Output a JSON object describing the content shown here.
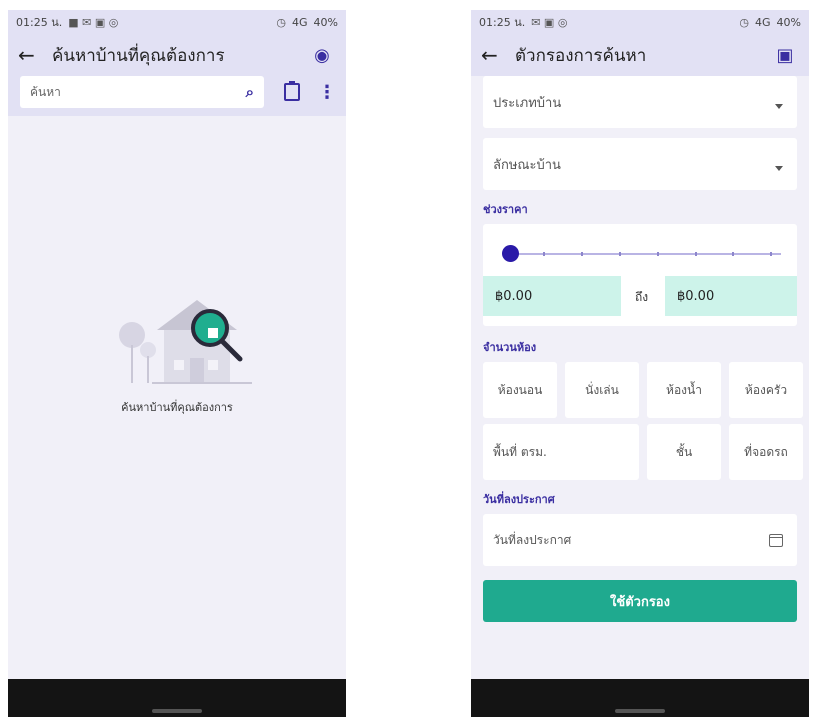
{
  "left": {
    "status": {
      "time": "01:25 น.",
      "signal": "4G",
      "battery": "40%"
    },
    "appbar": {
      "title": "ค้นหาบ้านที่คุณต้องการ"
    },
    "search": {
      "placeholder": "ค้นหา"
    },
    "empty_state": {
      "message": "ค้นหาบ้านที่คุณต้องการ"
    }
  },
  "right": {
    "status": {
      "time": "01:25 น.",
      "signal": "4G",
      "battery": "40%"
    },
    "appbar": {
      "title": "ตัวกรองการค้นหา"
    },
    "filters": {
      "house_type": "ประเภทบ้าน",
      "house_style": "ลักษณะบ้าน",
      "price_range_label": "ช่วงราคา",
      "price_min": "฿0.00",
      "price_to": "ถึง",
      "price_max": "฿0.00",
      "price_slider_value": 0,
      "rooms_label": "จำนวนห้อง",
      "rooms": [
        "ห้องนอน",
        "นั่งเล่น",
        "ห้องน้ำ",
        "ห้องครัว"
      ],
      "area": "พื้นที่ ตรม.",
      "floor": "ชั้น",
      "parking": "ที่จอดรถ",
      "post_date_label": "วันที่ลงประกาศ",
      "post_date_placeholder": "วันที่ลงประกาศ",
      "apply_label": "ใช้ตัวกรอง"
    }
  },
  "colors": {
    "accent": "#3a2ea1",
    "appbar": "#e2e1f4",
    "button": "#1faa8f",
    "price_field": "#cdf3ea"
  }
}
